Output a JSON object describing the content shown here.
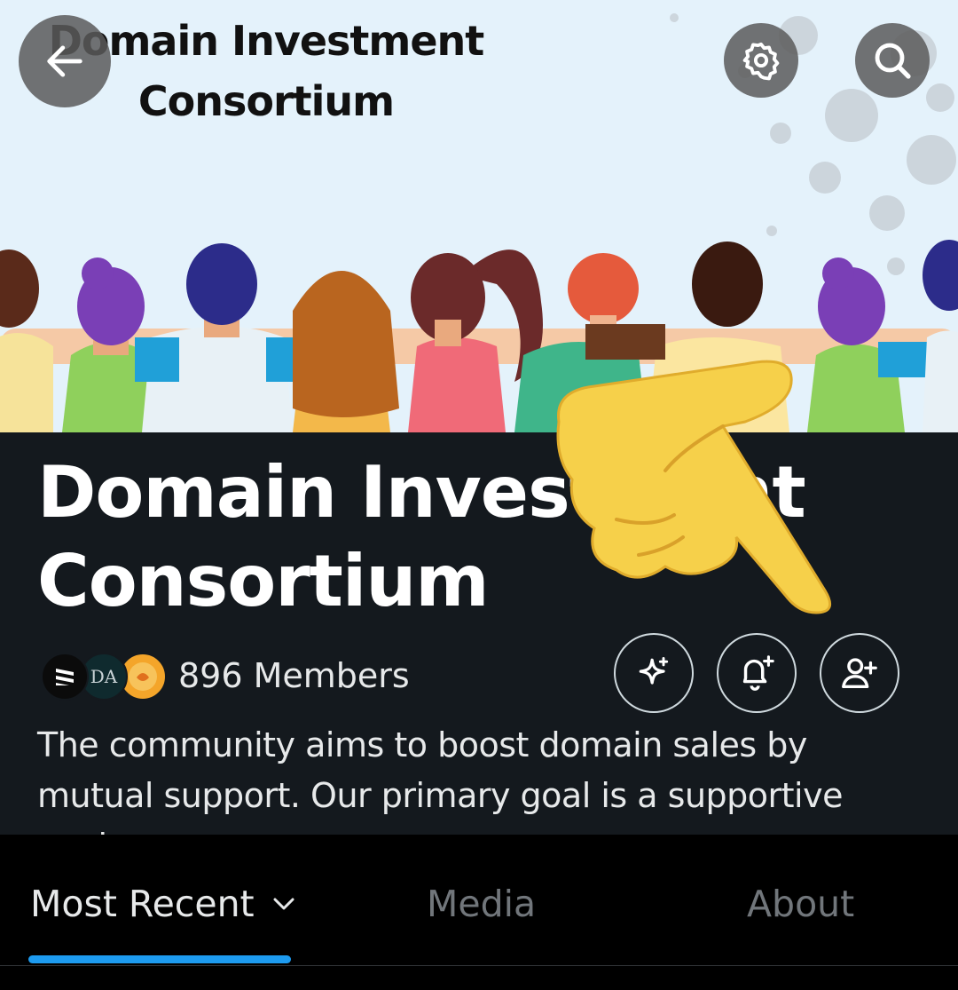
{
  "banner": {
    "title_line1": "Domain Investment",
    "title_line2": "Consortium"
  },
  "nav": {
    "back_icon": "arrow-left-icon",
    "settings_icon": "gear-icon",
    "search_icon": "search-icon"
  },
  "community": {
    "name_line1": "Domain Investment",
    "name_line2": "Consortium",
    "members_text": "896 Members",
    "member_avatars": [
      {
        "icon": "member-avatar-stripes",
        "color": "#0b0b0b"
      },
      {
        "icon": "member-avatar-da",
        "label": "DA",
        "color": "#0f2a2e"
      },
      {
        "icon": "member-avatar-orange",
        "color": "#f4a52a"
      }
    ],
    "description": "The community aims to boost domain sales by mutual support. Our primary goal is a supportive environmen..."
  },
  "actions": {
    "sparkle_icon": "sparkle-icon",
    "bell_icon": "bell-plus-icon",
    "join_icon": "user-plus-icon"
  },
  "tabs": [
    {
      "label": "Most Recent",
      "active": true
    },
    {
      "label": "Media",
      "active": false
    },
    {
      "label": "About",
      "active": false
    }
  ],
  "colors": {
    "accent": "#1d9bf0",
    "header_bg": "#14191e",
    "banner_bg": "#e4f2fb",
    "text_primary": "#e7e9ea",
    "text_secondary": "#71767b"
  }
}
